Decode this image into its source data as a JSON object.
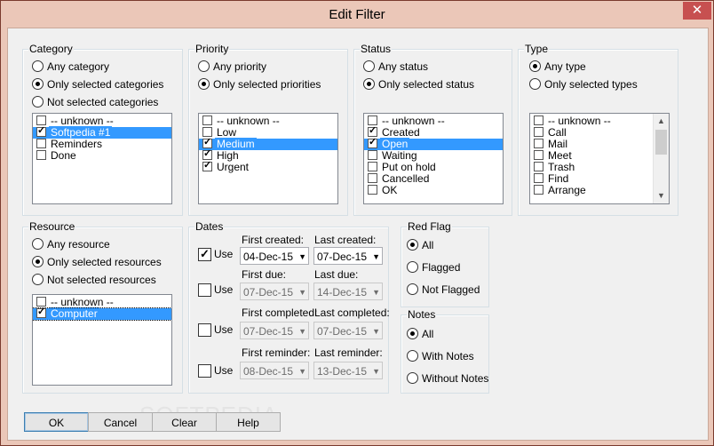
{
  "window": {
    "title": "Edit Filter",
    "close_glyph": "✕"
  },
  "category": {
    "label": "Category",
    "options": [
      "Any category",
      "Only selected categories",
      "Not selected categories"
    ],
    "selected_option": 1,
    "items": [
      {
        "label": "-- unknown --",
        "checked": false
      },
      {
        "label": "Softpedia #1",
        "checked": true,
        "selected": true
      },
      {
        "label": "Reminders",
        "checked": false
      },
      {
        "label": "Done",
        "checked": false
      }
    ]
  },
  "priority": {
    "label": "Priority",
    "options": [
      "Any priority",
      "Only selected priorities"
    ],
    "selected_option": 1,
    "items": [
      {
        "label": "-- unknown --",
        "checked": false
      },
      {
        "label": "Low",
        "checked": false
      },
      {
        "label": "Medium",
        "checked": true,
        "selected": true
      },
      {
        "label": "High",
        "checked": true
      },
      {
        "label": "Urgent",
        "checked": true
      }
    ]
  },
  "status": {
    "label": "Status",
    "options": [
      "Any status",
      "Only selected status"
    ],
    "selected_option": 1,
    "items": [
      {
        "label": "-- unknown --",
        "checked": false
      },
      {
        "label": "Created",
        "checked": true
      },
      {
        "label": "Open",
        "checked": true,
        "selected": true
      },
      {
        "label": "Waiting",
        "checked": false
      },
      {
        "label": "Put on hold",
        "checked": false
      },
      {
        "label": "Cancelled",
        "checked": false
      },
      {
        "label": "OK",
        "checked": false
      }
    ]
  },
  "type": {
    "label": "Type",
    "options": [
      "Any type",
      "Only selected types"
    ],
    "selected_option": 0,
    "items": [
      {
        "label": "-- unknown --",
        "checked": false
      },
      {
        "label": "Call",
        "checked": false
      },
      {
        "label": "Mail",
        "checked": false
      },
      {
        "label": "Meet",
        "checked": false
      },
      {
        "label": "Trash",
        "checked": false
      },
      {
        "label": "Find",
        "checked": false
      },
      {
        "label": "Arrange",
        "checked": false
      }
    ]
  },
  "resource": {
    "label": "Resource",
    "options": [
      "Any resource",
      "Only selected resources",
      "Not selected resources"
    ],
    "selected_option": 1,
    "items": [
      {
        "label": "-- unknown --",
        "checked": false
      },
      {
        "label": "Computer",
        "checked": true,
        "selected": true
      }
    ]
  },
  "dates": {
    "label": "Dates",
    "use_label": "Use",
    "rows": [
      {
        "use": true,
        "first_label": "First created:",
        "last_label": "Last created:",
        "first_value": "04-Dec-15",
        "last_value": "07-Dec-15"
      },
      {
        "use": false,
        "first_label": "First due:",
        "last_label": "Last due:",
        "first_value": "07-Dec-15",
        "last_value": "14-Dec-15"
      },
      {
        "use": false,
        "first_label": "First completed:",
        "last_label": "Last completed:",
        "first_value": "07-Dec-15",
        "last_value": "07-Dec-15"
      },
      {
        "use": false,
        "first_label": "First reminder:",
        "last_label": "Last reminder:",
        "first_value": "08-Dec-15",
        "last_value": "13-Dec-15"
      }
    ]
  },
  "red_flag": {
    "label": "Red Flag",
    "options": [
      "All",
      "Flagged",
      "Not Flagged"
    ],
    "selected_option": 0
  },
  "notes": {
    "label": "Notes",
    "options": [
      "All",
      "With Notes",
      "Without Notes"
    ],
    "selected_option": 0
  },
  "buttons": {
    "ok": "OK",
    "cancel": "Cancel",
    "clear": "Clear",
    "help": "Help"
  },
  "watermark": "SOFTPEDIA"
}
